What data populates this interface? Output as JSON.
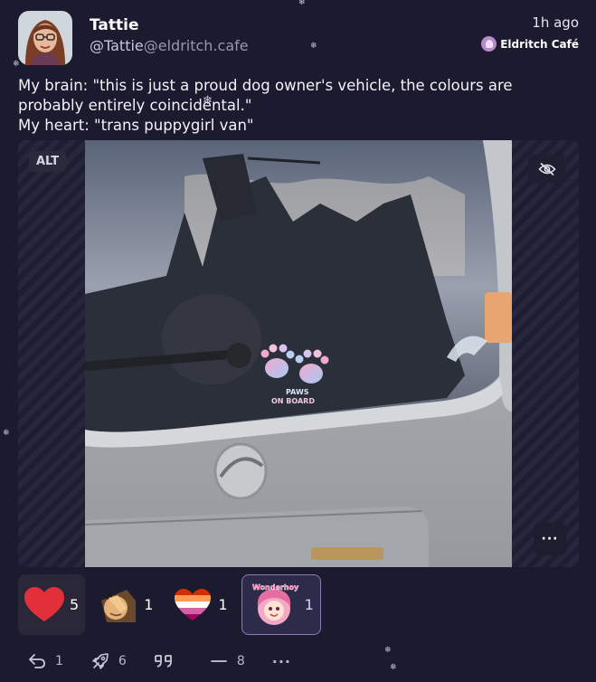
{
  "post": {
    "author": {
      "display_name": "Tattie",
      "handle_user": "@Tattie",
      "handle_domain": "@eldritch.cafe"
    },
    "time": "1h ago",
    "instance": {
      "name": "Eldritch Café"
    },
    "text": [
      "My brain: \"this is just a proud dog owner's vehicle, the colours are",
      "probably entirely coincidental.\"",
      "My heart: \"trans puppygirl van\""
    ]
  },
  "media": {
    "alt_label": "ALT",
    "more_label": "···",
    "sticker_text": [
      "PAWS",
      "ON BOARD"
    ]
  },
  "reactions": [
    {
      "emoji": "heart",
      "count": "5"
    },
    {
      "emoji": "facepalm-blob",
      "count": "1"
    },
    {
      "emoji": "lesbian-flag-heart",
      "count": "1"
    },
    {
      "emoji": "wonderhoy",
      "count": "1",
      "emoji_text": "Wonderhoy!"
    }
  ],
  "actions": [
    {
      "icon": "reply-icon",
      "count": "1"
    },
    {
      "icon": "boost-icon",
      "count": "6"
    },
    {
      "icon": "quote-icon",
      "count": ""
    },
    {
      "icon": "react-icon",
      "count": "8"
    },
    {
      "icon": "more-icon",
      "label": "···"
    }
  ],
  "colors": {
    "background": "#1c1a2e",
    "accent": "#8c7ab8",
    "heart": "#e2303b"
  }
}
